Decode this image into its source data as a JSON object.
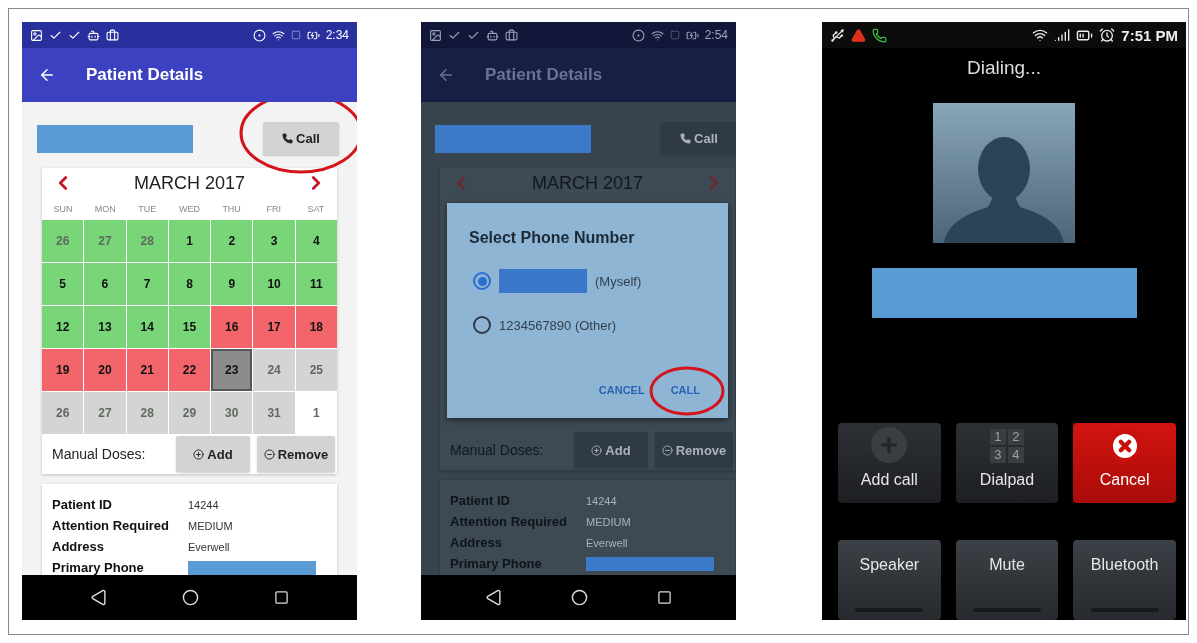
{
  "patient_screens": [
    {
      "status_time": "2:34",
      "title": "Patient Details",
      "patient_name": {
        "redacted": true
      },
      "call_button": {
        "label": "Call",
        "circled": true
      },
      "calendar": {
        "month": "MARCH 2017",
        "weekdays": [
          "SUN",
          "MON",
          "TUE",
          "WED",
          "THU",
          "FRI",
          "SAT"
        ],
        "days": [
          {
            "label": "26",
            "color": "#78d678",
            "dim": true,
            "selected": false
          },
          {
            "label": "27",
            "color": "#78d678",
            "dim": true,
            "selected": false
          },
          {
            "label": "28",
            "color": "#78d678",
            "dim": true,
            "selected": false
          },
          {
            "label": "1",
            "color": "#78d678",
            "dim": false,
            "selected": false
          },
          {
            "label": "2",
            "color": "#78d678",
            "dim": false,
            "selected": false
          },
          {
            "label": "3",
            "color": "#78d678",
            "dim": false,
            "selected": false
          },
          {
            "label": "4",
            "color": "#78d678",
            "dim": false,
            "selected": false
          },
          {
            "label": "5",
            "color": "#78d678",
            "dim": false,
            "selected": false
          },
          {
            "label": "6",
            "color": "#78d678",
            "dim": false,
            "selected": false
          },
          {
            "label": "7",
            "color": "#78d678",
            "dim": false,
            "selected": false
          },
          {
            "label": "8",
            "color": "#78d678",
            "dim": false,
            "selected": false
          },
          {
            "label": "9",
            "color": "#78d678",
            "dim": false,
            "selected": false
          },
          {
            "label": "10",
            "color": "#78d678",
            "dim": false,
            "selected": false
          },
          {
            "label": "11",
            "color": "#78d678",
            "dim": false,
            "selected": false
          },
          {
            "label": "12",
            "color": "#78d678",
            "dim": false,
            "selected": false
          },
          {
            "label": "13",
            "color": "#78d678",
            "dim": false,
            "selected": false
          },
          {
            "label": "14",
            "color": "#78d678",
            "dim": false,
            "selected": false
          },
          {
            "label": "15",
            "color": "#78d678",
            "dim": false,
            "selected": false
          },
          {
            "label": "16",
            "color": "#f2656a",
            "dim": false,
            "selected": false
          },
          {
            "label": "17",
            "color": "#f2656a",
            "dim": false,
            "selected": false
          },
          {
            "label": "18",
            "color": "#f2656a",
            "dim": false,
            "selected": false
          },
          {
            "label": "19",
            "color": "#f2656a",
            "dim": false,
            "selected": false
          },
          {
            "label": "20",
            "color": "#f2656a",
            "dim": false,
            "selected": false
          },
          {
            "label": "21",
            "color": "#f2656a",
            "dim": false,
            "selected": false
          },
          {
            "label": "22",
            "color": "#f2656a",
            "dim": false,
            "selected": false
          },
          {
            "label": "23",
            "color": "#8c8c8c",
            "dim": false,
            "selected": true
          },
          {
            "label": "24",
            "color": "#d4d4d4",
            "dim": true,
            "selected": false
          },
          {
            "label": "25",
            "color": "#d4d4d4",
            "dim": true,
            "selected": false
          },
          {
            "label": "26",
            "color": "#d4d4d4",
            "dim": true,
            "selected": false
          },
          {
            "label": "27",
            "color": "#d4d4d4",
            "dim": true,
            "selected": false
          },
          {
            "label": "28",
            "color": "#d4d4d4",
            "dim": true,
            "selected": false
          },
          {
            "label": "29",
            "color": "#d4d4d4",
            "dim": true,
            "selected": false
          },
          {
            "label": "30",
            "color": "#d4d4d4",
            "dim": true,
            "selected": false
          },
          {
            "label": "31",
            "color": "#d4d4d4",
            "dim": true,
            "selected": false
          },
          {
            "label": "1",
            "color": "#ffffff",
            "dim": true,
            "selected": false
          }
        ]
      },
      "manual_doses": {
        "label": "Manual Doses:",
        "add": "Add",
        "remove": "Remove"
      },
      "details": [
        {
          "label": "Patient ID",
          "value": "14244",
          "redacted": false
        },
        {
          "label": "Attention Required",
          "value": "MEDIUM",
          "redacted": false
        },
        {
          "label": "Address",
          "value": "Everwell",
          "redacted": false
        },
        {
          "label": "Primary Phone",
          "redacted": true
        }
      ]
    },
    {
      "status_time": "2:54",
      "title": "Patient Details",
      "patient_name": {
        "redacted": true
      },
      "call_button": {
        "label": "Call",
        "circled": false
      },
      "calendar": {
        "month": "MARCH 2017"
      },
      "dialog": {
        "title": "Select Phone Number",
        "options": [
          {
            "label": "(Myself)",
            "redacted": true,
            "selected": true
          },
          {
            "label": "1234567890 (Other)",
            "redacted": false,
            "selected": false
          }
        ],
        "buttons": [
          {
            "label": "CANCEL",
            "circled": false
          },
          {
            "label": "CALL",
            "circled": true
          }
        ]
      },
      "manual_doses": {
        "label": "Manual Doses:",
        "add": "Add",
        "remove": "Remove"
      },
      "details": [
        {
          "label": "Patient ID",
          "value": "14244",
          "redacted": false
        },
        {
          "label": "Attention Required",
          "value": "MEDIUM",
          "redacted": false
        },
        {
          "label": "Address",
          "value": "Everwell",
          "redacted": false
        },
        {
          "label": "Primary Phone",
          "redacted": true
        }
      ]
    }
  ],
  "call_screen": {
    "status_time": "7:51 PM",
    "status": "Dialing...",
    "number": {
      "redacted": true
    },
    "buttons": [
      {
        "label": "Add call",
        "kind": "add"
      },
      {
        "label": "Dialpad",
        "kind": "dialpad",
        "keys": [
          "1",
          "2",
          "3",
          "4"
        ]
      },
      {
        "label": "Cancel",
        "kind": "cancel"
      },
      {
        "label": "Speaker",
        "kind": "toggle"
      },
      {
        "label": "Mute",
        "kind": "toggle"
      },
      {
        "label": "Bluetooth",
        "kind": "toggle"
      }
    ]
  }
}
